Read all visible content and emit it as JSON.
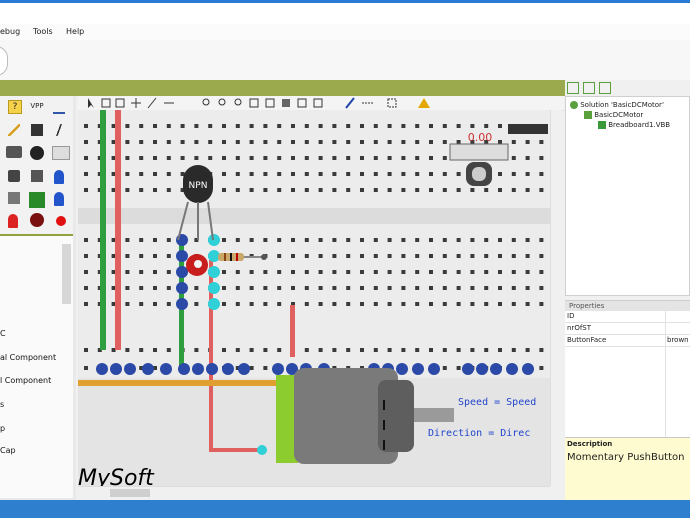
{
  "menu": {
    "items": [
      "ebug",
      "Tools",
      "Help"
    ]
  },
  "palette": {
    "labels": [
      "?",
      "VPP"
    ]
  },
  "component_list": {
    "items": [
      "C",
      "al Component",
      "l Component",
      "s",
      "p",
      "Cap"
    ]
  },
  "breadboard": {
    "transistor_label": "NPN",
    "motor_readout": "0.00",
    "speed_text": "Speed = Speed",
    "direction_text": "Direction = Direc"
  },
  "solution": {
    "root": "Solution 'BasicDCMotor'",
    "project": "BasicDCMotor",
    "file": "Breadboard1.VBB"
  },
  "properties": {
    "header": "Properties",
    "rows": [
      {
        "name": "ID",
        "value": ""
      },
      {
        "name": "nrOfST",
        "value": ""
      },
      {
        "name": "ButtonFace",
        "value": "brown"
      }
    ]
  },
  "description": {
    "title": "Description",
    "text": "Momentary PushButton"
  },
  "colors": {
    "accent_green": "#9caa4e",
    "status_blue": "#2f7fcf",
    "wire_green": "#2e9e3e",
    "wire_red": "#e06060"
  },
  "icons": [
    "help-icon",
    "vpp-icon",
    "ground-icon",
    "pointer-icon",
    "zoom-icon",
    "warning-icon",
    "motor-icon",
    "transistor-icon",
    "resistor-icon"
  ]
}
